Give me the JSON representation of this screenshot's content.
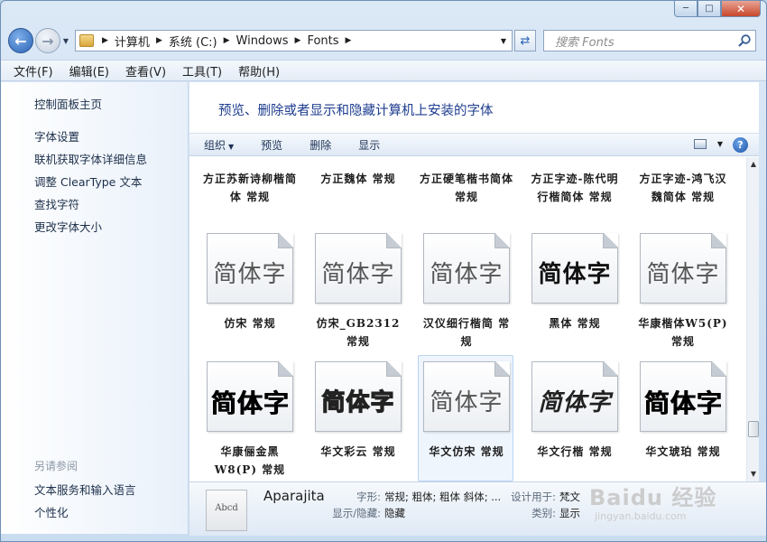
{
  "window": {
    "caption": {
      "minimize": "─",
      "maximize": "□",
      "close": "✕"
    }
  },
  "nav": {
    "breadcrumb": [
      "计算机",
      "系统 (C:)",
      "Windows",
      "Fonts"
    ],
    "search_placeholder": "搜索 Fonts"
  },
  "menu": [
    "文件(F)",
    "编辑(E)",
    "查看(V)",
    "工具(T)",
    "帮助(H)"
  ],
  "sidebar": {
    "links": [
      "控制面板主页",
      "字体设置",
      "联机获取字体详细信息",
      "调整 ClearType 文本",
      "查找字符",
      "更改字体大小"
    ],
    "see_also_heading": "另请参阅",
    "see_also": [
      "文本服务和输入语言",
      "个性化"
    ]
  },
  "content": {
    "title": "预览、删除或者显示和隐藏计算机上安装的字体",
    "commands": [
      "组织",
      "预览",
      "删除",
      "显示"
    ],
    "sample_text": "简体字",
    "fonts_row1": [
      "方正苏新诗柳楷简体 常规",
      "方正魏体 常规",
      "方正硬笔楷书简体 常规",
      "方正字迹-陈代明行楷简体 常规",
      "方正字迹-鸿飞汉魏简体 常规"
    ],
    "fonts_row2": [
      "仿宋 常规",
      "仿宋_GB2312 常规",
      "汉仪细行楷简 常规",
      "黑体 常规",
      "华康楷体W5(P) 常规"
    ],
    "fonts_row3": [
      "华康俪金黑W8(P) 常规",
      "华文彩云 常规",
      "华文仿宋 常规",
      "华文行楷 常规",
      "华文琥珀 常规"
    ]
  },
  "details": {
    "thumb_text": "Abcd",
    "name": "Aparajita",
    "style_label": "字形:",
    "style_value": "常规; 粗体; 粗体 斜体; ...",
    "designed_for_label": "设计用于:",
    "designed_for_value": "梵文",
    "show_hide_label": "显示/隐藏:",
    "show_hide_value": "隐藏",
    "category_label": "类别:",
    "category_value": "显示"
  },
  "watermark": {
    "main": "Baidu 经验",
    "sub": "jingyan.baidu.com"
  }
}
